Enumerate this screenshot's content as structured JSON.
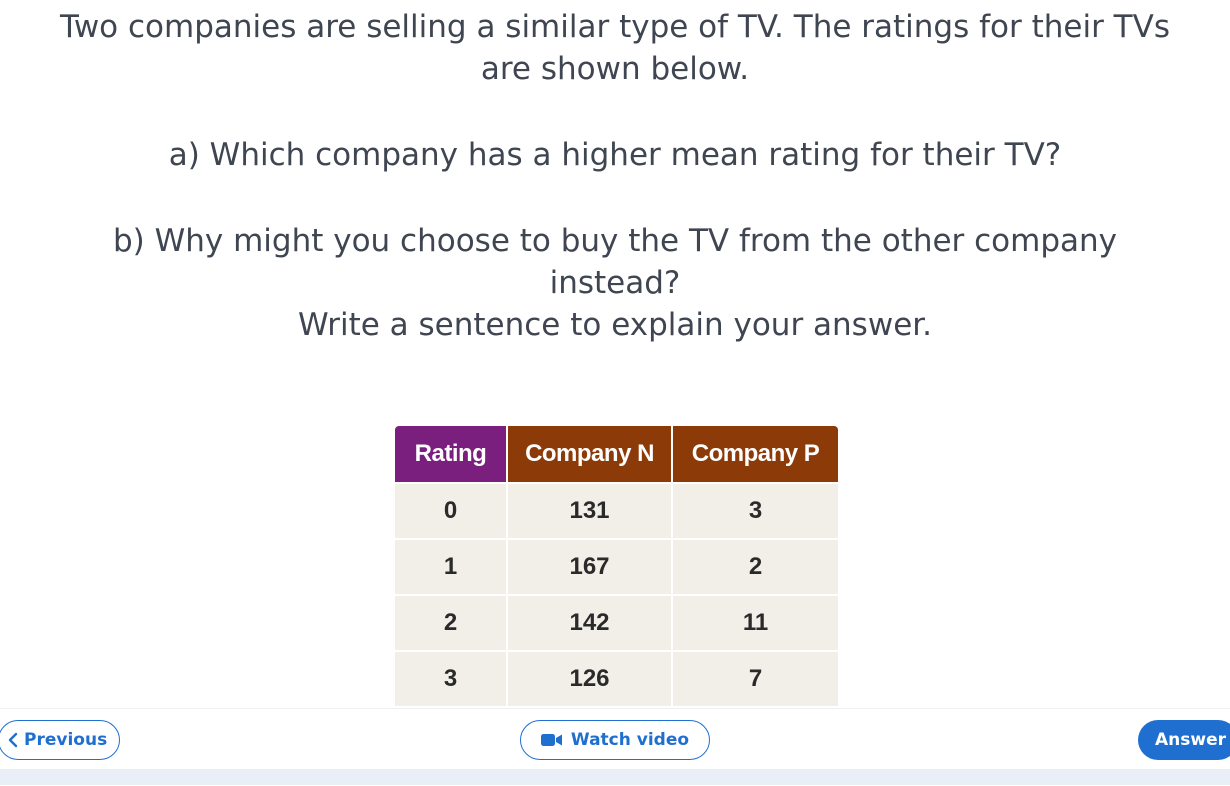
{
  "question": {
    "intro_line1": "Two companies are selling a similar type of TV. The ratings for their TVs",
    "intro_line2": "are shown below.",
    "part_a": "a) Which company has a higher mean rating for their TV?",
    "part_b_line1": "b) Why might you choose to buy the TV from the other company",
    "part_b_line2": "instead?",
    "part_b_line3": "Write a sentence to explain your answer."
  },
  "table": {
    "headers": [
      "Rating",
      "Company N",
      "Company P"
    ],
    "header_colors": {
      "rating": "#7b1f7e",
      "company": "#8b3a08"
    },
    "rows": [
      [
        "0",
        "131",
        "3"
      ],
      [
        "1",
        "167",
        "2"
      ],
      [
        "2",
        "142",
        "11"
      ],
      [
        "3",
        "126",
        "7"
      ]
    ]
  },
  "navigation": {
    "previous_label": "Previous",
    "video_label": "Watch video",
    "answer_label": "Answer",
    "accent_color": "#1f6fd1",
    "icons": {
      "previous": "chevron-left-icon",
      "video": "video-camera-icon"
    }
  }
}
